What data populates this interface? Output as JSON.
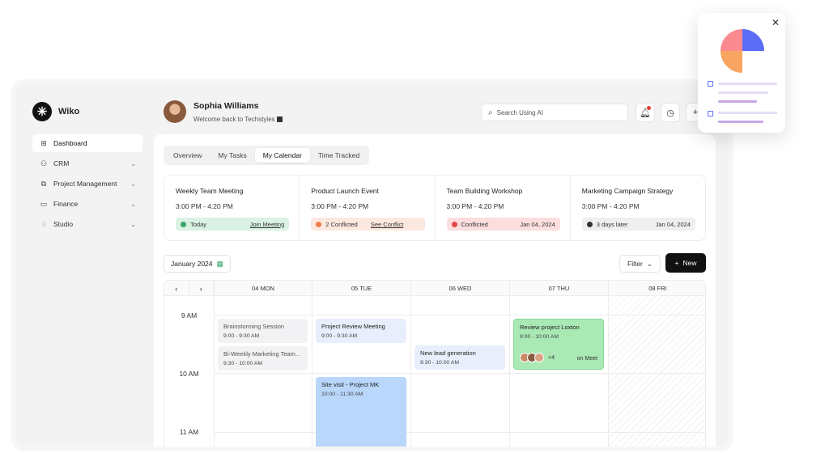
{
  "app": {
    "name": "Wiko"
  },
  "sidebar": {
    "items": [
      {
        "label": "Dashboard",
        "icon": "grid-icon",
        "active": true,
        "expandable": false
      },
      {
        "label": "CRM",
        "icon": "users-icon",
        "expandable": true
      },
      {
        "label": "Project Management",
        "icon": "folders-icon",
        "expandable": true
      },
      {
        "label": "Finance",
        "icon": "folder-icon",
        "expandable": true
      },
      {
        "label": "Studio",
        "icon": "diamond-icon",
        "expandable": true
      }
    ]
  },
  "header": {
    "user_name": "Sophia Williams",
    "welcome": "Welcome back to Techstyles",
    "search_placeholder": "Search Using AI"
  },
  "tabs": [
    "Overview",
    "My Tasks",
    "My Calendar",
    "Time Tracked"
  ],
  "active_tab": "My Calendar",
  "events": [
    {
      "title": "Weekly Team Meeting",
      "time": "3:00 PM - 4:20 PM",
      "status": "Today",
      "action": "Join Meeting",
      "tone": "green"
    },
    {
      "title": "Product Launch Event",
      "time": "3:00 PM - 4:20 PM",
      "status": "2 Conflicted",
      "action": "See Conflict",
      "tone": "orange"
    },
    {
      "title": "Team Building Workshop",
      "time": "3:00 PM - 4:20 PM",
      "status": "Conflicted",
      "date": "Jan 04, 2024",
      "tone": "red"
    },
    {
      "title": "Marketing Campaign Strategy",
      "time": "3:00 PM - 4:20 PM",
      "status": "3 days later",
      "date": "Jan 04, 2024",
      "tone": "gray"
    }
  ],
  "calendar": {
    "month_label": "January 2024",
    "filter_label": "Filter",
    "new_label": "New",
    "prev": "‹",
    "next": "›",
    "days": [
      "04 MON",
      "05 TUE",
      "06 WED",
      "07 THU",
      "08 FRI"
    ],
    "times": [
      "9 AM",
      "10 AM",
      "11 AM"
    ],
    "items": [
      {
        "title": "Brainstorming Session",
        "time": "9:00 - 9:30 AM",
        "day": "04 MON"
      },
      {
        "title": "Bi-Weekly Marketing Team...",
        "time": "9:30 - 10:00 AM",
        "day": "04 MON"
      },
      {
        "title": "Project Review Meeting",
        "time": "9:00 - 9:30 AM",
        "day": "05 TUE"
      },
      {
        "title": "Site visit - Project MK",
        "time": "10:00 - 11:30 AM",
        "day": "05 TUE"
      },
      {
        "title": "New lead generation",
        "time": "9:30 - 10:00 AM",
        "day": "06 WED"
      },
      {
        "title": "Review project Loxton",
        "time": "9:00 - 10:00 AM",
        "day": "07 THU",
        "more_attendees": "+4",
        "location": "on Meet"
      }
    ]
  },
  "colors": {
    "accent": "#111111",
    "green": "#a9e9b4",
    "blue": "#b9d6fb",
    "pie_blue": "#5b6cf5",
    "pie_orange": "#f7a561"
  }
}
